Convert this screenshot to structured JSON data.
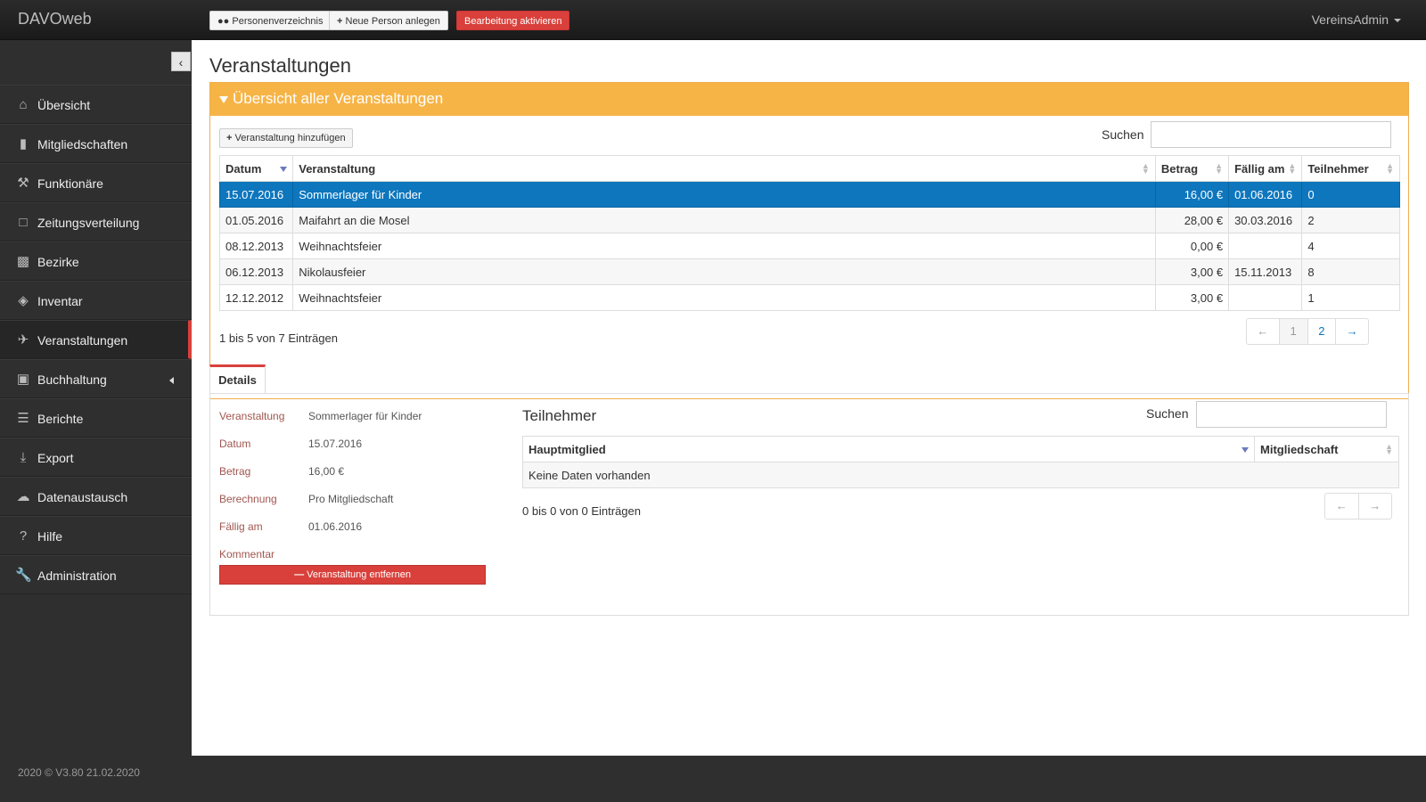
{
  "app": {
    "brand": "DAVOweb",
    "user": "VereinsAdmin",
    "footer": "2020 © V3.80 21.02.2020"
  },
  "toolbar": {
    "people_btn": "Personenverzeichnis",
    "new_person_btn": "Neue Person anlegen",
    "edit_btn": "Bearbeitung aktivieren"
  },
  "sidebar": {
    "items": [
      {
        "label": "Übersicht",
        "icon": "home-icon"
      },
      {
        "label": "Mitgliedschaften",
        "icon": "book-icon"
      },
      {
        "label": "Funktionäre",
        "icon": "gavel-icon"
      },
      {
        "label": "Zeitungsverteilung",
        "icon": "file-icon"
      },
      {
        "label": "Bezirke",
        "icon": "briefcase-icon"
      },
      {
        "label": "Inventar",
        "icon": "tags-icon"
      },
      {
        "label": "Veranstaltungen",
        "icon": "plane-icon"
      },
      {
        "label": "Buchhaltung",
        "icon": "money-icon"
      },
      {
        "label": "Berichte",
        "icon": "list-icon"
      },
      {
        "label": "Export",
        "icon": "download-icon"
      },
      {
        "label": "Datenaustausch",
        "icon": "cloud-icon"
      },
      {
        "label": "Hilfe",
        "icon": "question-icon"
      },
      {
        "label": "Administration",
        "icon": "wrench-icon"
      }
    ]
  },
  "page": {
    "title": "Veranstaltungen",
    "panel_title": "Übersicht aller Veranstaltungen",
    "add_btn": "Veranstaltung hinzufügen",
    "search_label": "Suchen",
    "columns": [
      "Datum",
      "Veranstaltung",
      "Betrag",
      "Fällig am",
      "Teilnehmer"
    ],
    "rows": [
      [
        "15.07.2016",
        "Sommerlager für Kinder",
        "16,00 €",
        "01.06.2016",
        "0"
      ],
      [
        "01.05.2016",
        "Maifahrt an die Mosel",
        "28,00 €",
        "30.03.2016",
        "2"
      ],
      [
        "08.12.2013",
        "Weihnachtsfeier",
        "0,00 €",
        "",
        "4"
      ],
      [
        "06.12.2013",
        "Nikolausfeier",
        "3,00 €",
        "15.11.2013",
        "8"
      ],
      [
        "12.12.2012",
        "Weihnachtsfeier",
        "3,00 €",
        "",
        "1"
      ]
    ],
    "info": "1 bis 5 von 7 Einträgen",
    "pager": {
      "prev": "←",
      "p1": "1",
      "p2": "2",
      "next": "→"
    }
  },
  "details": {
    "tab": "Details",
    "labels": [
      "Veranstaltung",
      "Datum",
      "Betrag",
      "Berechnung",
      "Fällig am",
      "Kommentar"
    ],
    "values": [
      "Sommerlager für Kinder",
      "15.07.2016",
      "16,00 €",
      "Pro Mitgliedschaft",
      "01.06.2016",
      ""
    ],
    "remove_btn": "Veranstaltung entfernen",
    "participants": {
      "title": "Teilnehmer",
      "search_label": "Suchen",
      "columns": [
        "Hauptmitglied",
        "Mitgliedschaft"
      ],
      "empty": "Keine Daten vorhanden",
      "info": "0 bis 0 von 0 Einträgen",
      "prev": "←",
      "next": "→"
    }
  }
}
